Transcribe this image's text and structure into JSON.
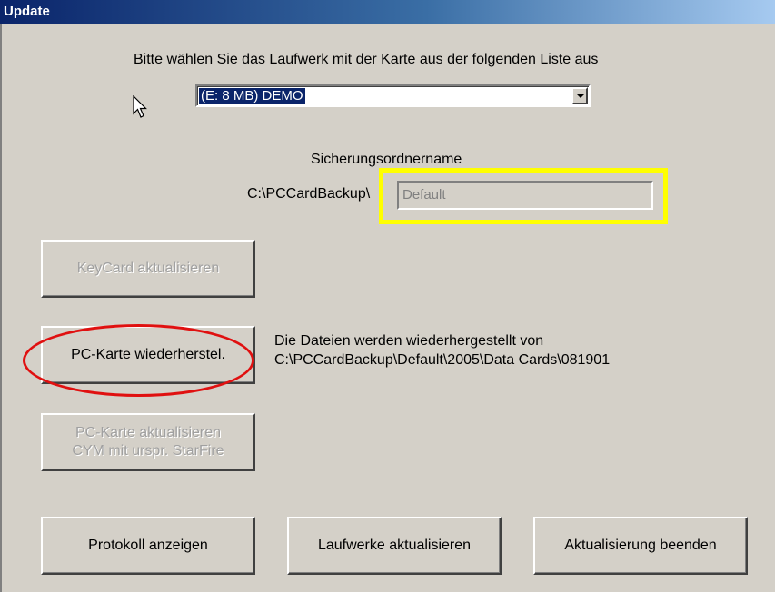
{
  "window": {
    "title": "Update"
  },
  "instruction": "Bitte wählen Sie das Laufwerk mit der Karte aus der folgenden Liste aus",
  "drive_select": {
    "selected": "(E: 8 MB) DEMO"
  },
  "backup_folder": {
    "label": "Sicherungsordnername",
    "prefix": "C:\\PCCardBackup\\",
    "placeholder": "Default"
  },
  "buttons": {
    "keycard_update": "KeyCard aktualisieren",
    "pc_card_restore": "PC-Karte wiederherstel.",
    "pc_card_update_line1": "PC-Karte aktualisieren",
    "pc_card_update_line2": "CYM mit urspr. StarFire",
    "show_log": "Protokoll anzeigen",
    "refresh_drives": "Laufwerke aktualisieren",
    "exit_update": "Aktualisierung beenden"
  },
  "restore_info": {
    "line1": "Die Dateien werden wiederhergestellt von",
    "line2": "C:\\PCCardBackup\\Default\\2005\\Data Cards\\081901"
  },
  "colors": {
    "annotation_highlight": "#ffff00",
    "annotation_circle": "#e01010",
    "titlebar": "#0a246a",
    "window_bg": "#d4d0c8"
  }
}
